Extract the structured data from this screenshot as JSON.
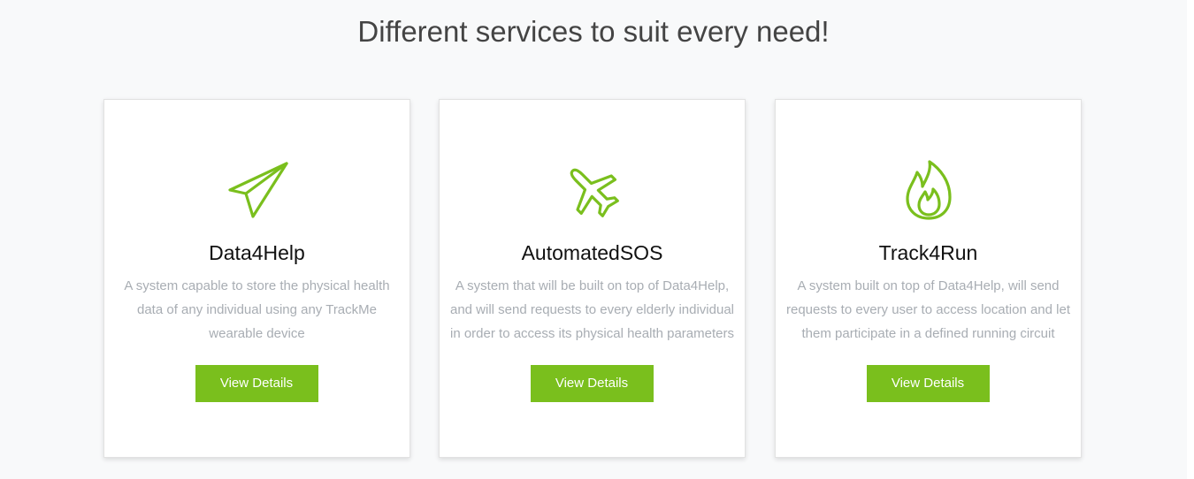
{
  "section": {
    "title": "Different services to suit every need!"
  },
  "colors": {
    "accent": "#7abf1d",
    "background": "#f8f9fa",
    "title": "#444444",
    "body_text": "#a8adb3"
  },
  "cards": [
    {
      "icon": "paper-plane-icon",
      "title": "Data4Help",
      "description": "A system capable to store the physical health data of any individual using any TrackMe wearable device",
      "button_label": "View Details"
    },
    {
      "icon": "airplane-icon",
      "title": "AutomatedSOS",
      "description": "A system that will be built on top of Data4Help, and will send requests to every elderly individual in order to access its physical health parameters",
      "button_label": "View Details"
    },
    {
      "icon": "fire-icon",
      "title": "Track4Run",
      "description": "A system built on top of Data4Help, will send requests to every user to access location and let them participate in a defined running circuit",
      "button_label": "View Details"
    }
  ]
}
